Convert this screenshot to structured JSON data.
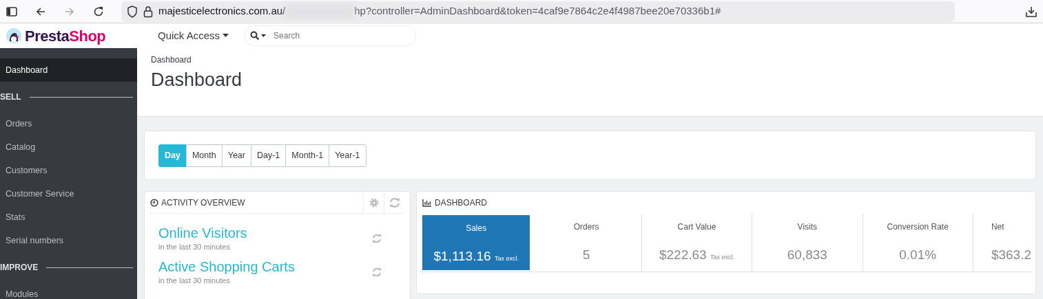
{
  "browser": {
    "url_host": "majesticelectronics.com.au/",
    "url_rest": "hp?controller=AdminDashboard&token=4caf9e7864c2e4f4987bee20e70336b1#"
  },
  "header": {
    "logo_parts": [
      "Presta",
      "Shop"
    ],
    "quick_access": "Quick Access",
    "search": {
      "placeholder": "Search"
    }
  },
  "sidebar": {
    "top_items": [
      {
        "label": "Dashboard",
        "selected": true
      }
    ],
    "sections": [
      {
        "title": "SELL",
        "items": [
          {
            "label": "Orders",
            "selected": false
          },
          {
            "label": "Catalog",
            "selected": false
          },
          {
            "label": "Customers",
            "selected": false
          },
          {
            "label": "Customer Service",
            "selected": false
          },
          {
            "label": "Stats",
            "selected": false
          },
          {
            "label": "Serial numbers",
            "selected": false
          }
        ]
      },
      {
        "title": "IMPROVE",
        "items": [
          {
            "label": "Modules",
            "selected": false
          }
        ]
      }
    ]
  },
  "page": {
    "breadcrumb": "Dashboard",
    "title": "Dashboard"
  },
  "periods": [
    {
      "label": "Day",
      "selected": true
    },
    {
      "label": "Month",
      "selected": false
    },
    {
      "label": "Year",
      "selected": false
    },
    {
      "label": "Day-1",
      "selected": false
    },
    {
      "label": "Month-1",
      "selected": false
    },
    {
      "label": "Year-1",
      "selected": false
    }
  ],
  "activity": {
    "title": "ACTIVITY OVERVIEW",
    "metrics": [
      {
        "title": "Online Visitors",
        "subtitle": "in the last 30 minutes"
      },
      {
        "title": "Active Shopping Carts",
        "subtitle": "in the last 30 minutes"
      }
    ]
  },
  "dashboard": {
    "title": "DASHBOARD",
    "kpis": [
      {
        "label": "Sales",
        "value": "$1,113.16",
        "note": "Tax excl.",
        "selected": true
      },
      {
        "label": "Orders",
        "value": "5",
        "selected": false
      },
      {
        "label": "Cart Value",
        "value": "$222.63",
        "note": "Tax excl.",
        "selected": false
      },
      {
        "label": "Visits",
        "value": "60,833",
        "selected": false
      },
      {
        "label": "Conversion Rate",
        "value": "0.01%",
        "selected": false
      },
      {
        "label": "Net",
        "value": "$363.2",
        "selected": false
      }
    ]
  }
}
